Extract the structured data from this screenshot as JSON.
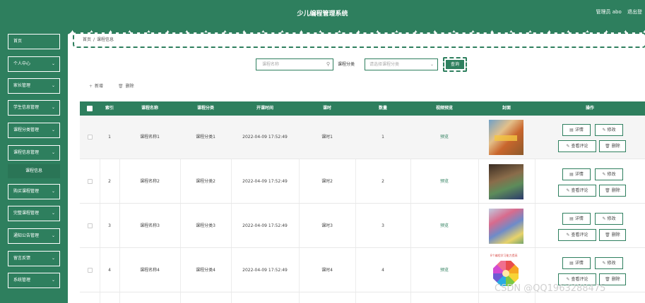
{
  "header": {
    "title": "少儿编程管理系统",
    "user_label": "管理员 abo",
    "logout_label": "退出登"
  },
  "sidebar": {
    "items": [
      {
        "label": "首页",
        "has_chevron": false
      },
      {
        "label": "个人中心",
        "has_chevron": true
      },
      {
        "label": "家长管理",
        "has_chevron": true
      },
      {
        "label": "学生信息管理",
        "has_chevron": true
      },
      {
        "label": "课程分类管理",
        "has_chevron": true
      },
      {
        "label": "课程信息管理",
        "has_chevron": true
      },
      {
        "label": "购买课程管理",
        "has_chevron": true
      },
      {
        "label": "完整课程管理",
        "has_chevron": true
      },
      {
        "label": "通知公告管理",
        "has_chevron": true
      },
      {
        "label": "留言反馈",
        "has_chevron": true
      },
      {
        "label": "系统管理",
        "has_chevron": true
      }
    ],
    "active_sub": "课程信息"
  },
  "breadcrumb": {
    "home": "首页",
    "sep": "/",
    "current": "课程信息"
  },
  "search": {
    "name_placeholder": "课程名称",
    "category_label": "课程分类",
    "category_placeholder": "请选择课程分类",
    "query_label": "查询"
  },
  "toolbar": {
    "add_label": "新增",
    "delete_label": "删除"
  },
  "table": {
    "columns": [
      "索引",
      "课程名称",
      "课程分类",
      "开课时间",
      "课时",
      "数量",
      "视频预览",
      "封面",
      "操作"
    ],
    "rows": [
      {
        "index": "1",
        "name": "课程名称1",
        "category": "课程分类1",
        "start_time": "2022-04-09 17:52:49",
        "lesson": "课时1",
        "quantity": "1",
        "preview": "预览"
      },
      {
        "index": "2",
        "name": "课程名称2",
        "category": "课程分类2",
        "start_time": "2022-04-09 17:52:49",
        "lesson": "课时2",
        "quantity": "2",
        "preview": "预览"
      },
      {
        "index": "3",
        "name": "课程名称3",
        "category": "课程分类3",
        "start_time": "2022-04-09 17:52:49",
        "lesson": "课时3",
        "quantity": "3",
        "preview": "预览"
      },
      {
        "index": "4",
        "name": "课程名称4",
        "category": "课程分类4",
        "start_time": "2022-04-09 17:52:49",
        "lesson": "课时4",
        "quantity": "4",
        "preview": "预览"
      }
    ],
    "actions": {
      "detail": "详情",
      "edit": "修改",
      "review": "查看评论",
      "delete": "删除"
    },
    "cover4_caption": "8个编程学习能力提高"
  },
  "watermark": "CSDN @QQ1963288475",
  "colors": {
    "accent": "#2e7f5e",
    "link": "#2e7f5e",
    "row_shade": "#f5f5f5"
  }
}
